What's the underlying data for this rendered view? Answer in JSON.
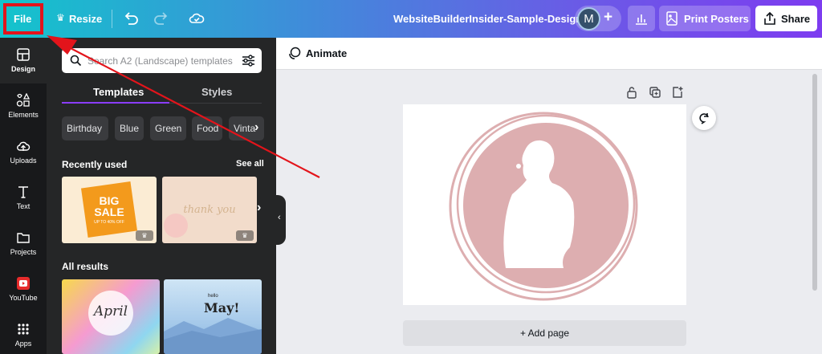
{
  "topbar": {
    "file_label": "File",
    "resize_label": "Resize",
    "doc_title": "WebsiteBuilderInsider-Sample-Design",
    "avatar_initial": "M",
    "print_label": "Print Posters",
    "share_label": "Share",
    "gradient_start": "#13c4cc",
    "gradient_end": "#7d3cf0",
    "highlight_color": "#e3141b"
  },
  "rail": {
    "items": [
      {
        "label": "Design",
        "icon": "layout-icon"
      },
      {
        "label": "Elements",
        "icon": "shapes-icon"
      },
      {
        "label": "Uploads",
        "icon": "cloud-upload-icon"
      },
      {
        "label": "Text",
        "icon": "text-icon"
      },
      {
        "label": "Projects",
        "icon": "folder-icon"
      },
      {
        "label": "YouTube",
        "icon": "youtube-icon"
      },
      {
        "label": "Apps",
        "icon": "apps-grid-icon"
      }
    ]
  },
  "panel": {
    "search_placeholder": "Search A2 (Landscape) templates",
    "tabs": [
      {
        "label": "Templates"
      },
      {
        "label": "Styles"
      }
    ],
    "chips": [
      {
        "label": "Birthday"
      },
      {
        "label": "Blue"
      },
      {
        "label": "Green"
      },
      {
        "label": "Food"
      },
      {
        "label": "Vinta"
      }
    ],
    "recent_title": "Recently used",
    "see_all": "See all",
    "all_results_title": "All results",
    "thumb1": {
      "line1": "BIG",
      "line2": "SALE",
      "line3": "UP TO 40% OFF"
    },
    "thumb2": {
      "text": "thank you"
    },
    "thumb3": {
      "text": "April"
    },
    "thumb4": {
      "line1": "hello",
      "line2": "May!"
    }
  },
  "canvas": {
    "animate_label": "Animate",
    "add_page_label": "+ Add page",
    "accent": "#ddaeb0"
  }
}
